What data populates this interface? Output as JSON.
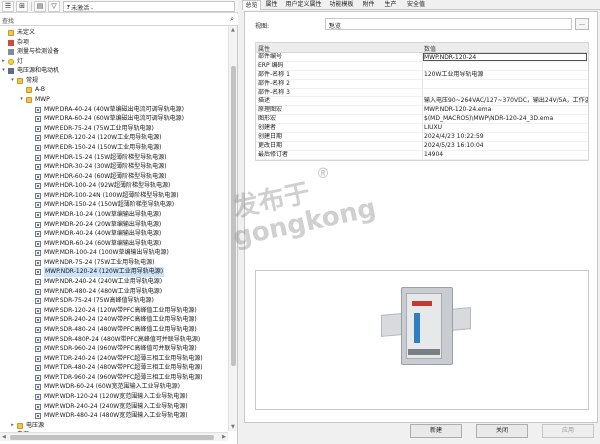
{
  "toolbar": {
    "combo_value": "- 未激活 -"
  },
  "search": {
    "value": "查找"
  },
  "tree": [
    {
      "label": "未定义",
      "depth": 1,
      "twisty": "",
      "icon": "folder"
    },
    {
      "label": "杂项",
      "depth": 1,
      "twisty": "",
      "icon": "book"
    },
    {
      "label": "测量与检测设备",
      "depth": 1,
      "twisty": "",
      "icon": "meter"
    },
    {
      "label": "灯",
      "depth": 1,
      "twisty": "▸",
      "icon": "bulb"
    },
    {
      "label": "电压源和电动机",
      "depth": 1,
      "twisty": "▾",
      "icon": "plug"
    },
    {
      "label": "常规",
      "depth": 2,
      "twisty": "▾",
      "icon": "folder"
    },
    {
      "label": "A-B",
      "depth": 3,
      "twisty": "",
      "icon": "folder"
    },
    {
      "label": "MWP",
      "depth": 3,
      "twisty": "▾",
      "icon": "folder"
    },
    {
      "label": "MWP.DRA-40-24 (40W草编磁出电流可调导轨电源)",
      "depth": 4,
      "icon": "prod"
    },
    {
      "label": "MWP.DRA-60-24 (60W草编磁出电流可调导轨电源)",
      "depth": 4,
      "icon": "prod"
    },
    {
      "label": "MWP.EDR-75-24 (75W工业用导轨电源)",
      "depth": 4,
      "icon": "prod"
    },
    {
      "label": "MWP.EDR-120-24 (120W工业用导轨电源)",
      "depth": 4,
      "icon": "prod"
    },
    {
      "label": "MWP.EDR-150-24 (150W工业用导轨电源)",
      "depth": 4,
      "icon": "prod"
    },
    {
      "label": "MWP.HDR-15-24 (15W超薄阶梯型导轨电源)",
      "depth": 4,
      "icon": "prod"
    },
    {
      "label": "MWP.HDR-30-24 (30W超薄阶梯型导轨电源)",
      "depth": 4,
      "icon": "prod"
    },
    {
      "label": "MWP.HDR-60-24 (60W超薄阶梯型导轨电源)",
      "depth": 4,
      "icon": "prod"
    },
    {
      "label": "MWP.HDR-100-24 (92W超薄阶梯型导轨电源)",
      "depth": 4,
      "icon": "prod"
    },
    {
      "label": "MWP.HDR-100-24N (100W超薄阶梯型导轨电源)",
      "depth": 4,
      "icon": "prod"
    },
    {
      "label": "MWP.HDR-150-24 (150W超薄阶梯型导轨电源)",
      "depth": 4,
      "icon": "prod"
    },
    {
      "label": "MWP.MDR-10-24 (10W草编输出导轨电源)",
      "depth": 4,
      "icon": "prod"
    },
    {
      "label": "MWP.MDR-20-24 (20W草编输出导轨电源)",
      "depth": 4,
      "icon": "prod"
    },
    {
      "label": "MWP.MDR-40-24 (40W草编输出导轨电源)",
      "depth": 4,
      "icon": "prod"
    },
    {
      "label": "MWP.MDR-60-24 (60W草编输出导轨电源)",
      "depth": 4,
      "icon": "prod"
    },
    {
      "label": "MWP.MDR-100-24 (100W草编输出导轨电源)",
      "depth": 4,
      "icon": "prod"
    },
    {
      "label": "MWP.NDR-75-24 (75W工业用导轨电源)",
      "depth": 4,
      "icon": "prod"
    },
    {
      "label": "MWP.NDR-120-24 (120W工业用导轨电源)",
      "depth": 4,
      "icon": "prod",
      "selected": true
    },
    {
      "label": "MWP.NDR-240-24 (240W工业用导轨电源)",
      "depth": 4,
      "icon": "prod"
    },
    {
      "label": "MWP.NDR-480-24 (480W工业用导轨电源)",
      "depth": 4,
      "icon": "prod"
    },
    {
      "label": "MWP.SDR-75-24 (75W高峰值导轨电源)",
      "depth": 4,
      "icon": "prod"
    },
    {
      "label": "MWP.SDR-120-24 (120W带PFC高峰值工业用导轨电源)",
      "depth": 4,
      "icon": "prod"
    },
    {
      "label": "MWP.SDR-240-24 (240W带PFC高峰值工业用导轨电源)",
      "depth": 4,
      "icon": "prod"
    },
    {
      "label": "MWP.SDR-480-24 (480W带PFC高峰值工业用导轨电源)",
      "depth": 4,
      "icon": "prod"
    },
    {
      "label": "MWP.SDR-480P-24 (480W带PFC高峰值可并联导轨电源)",
      "depth": 4,
      "icon": "prod"
    },
    {
      "label": "MWP.SDR-960-24 (960W带PFC高峰值可并联导轨电源)",
      "depth": 4,
      "icon": "prod"
    },
    {
      "label": "MWP.TDR-240-24 (240W带PFC超薄三相工业用导轨电源)",
      "depth": 4,
      "icon": "prod"
    },
    {
      "label": "MWP.TDR-480-24 (480W带PFC超薄三相工业用导轨电源)",
      "depth": 4,
      "icon": "prod"
    },
    {
      "label": "MWP.TDR-960-24 (960W带PFC超薄三相工业用导轨电源)",
      "depth": 4,
      "icon": "prod"
    },
    {
      "label": "MWP.WDR-60-24 (60W宽范围输入工业导轨电源)",
      "depth": 4,
      "icon": "prod"
    },
    {
      "label": "MWP.WDR-120-24 (120W宽范围输入工业导轨电源)",
      "depth": 4,
      "icon": "prod"
    },
    {
      "label": "MWP.WDR-240-24 (240W宽范围输入工业导轨电源)",
      "depth": 4,
      "icon": "prod"
    },
    {
      "label": "MWP.WDR-480-24 (480W宽范围输入工业导轨电源)",
      "depth": 4,
      "icon": "prod"
    },
    {
      "label": "电压源",
      "depth": 2,
      "twisty": "▸",
      "icon": "folder"
    },
    {
      "label": "电源",
      "depth": 1,
      "twisty": "▸",
      "icon": "folder"
    },
    {
      "label": "电机",
      "depth": 1,
      "twisty": "▸",
      "icon": "gear"
    }
  ],
  "tabs": [
    {
      "label": "总览",
      "active": true
    },
    {
      "label": "属性"
    },
    {
      "label": "用户定义属性"
    },
    {
      "label": "功能模板"
    },
    {
      "label": "附件"
    },
    {
      "label": "生产"
    },
    {
      "label": "安全值"
    }
  ],
  "view": {
    "label": "视图:",
    "value": "总览",
    "more_label": "..."
  },
  "grid": {
    "col_property": "属性",
    "col_value": "数值",
    "rows": [
      {
        "name": "部件编号",
        "value": "MWP.NDR-120-24",
        "hl": true
      },
      {
        "name": "ERP 编码",
        "value": ""
      },
      {
        "name": "部件-名称 1",
        "value": "120W工业用导轨电源"
      },
      {
        "name": "部件-名称 2",
        "value": ""
      },
      {
        "name": "部件-名称 3",
        "value": ""
      },
      {
        "name": "描述",
        "value": "输入电压90~264VAC/127~370VDC，输出24V/5A，工作温度-..."
      },
      {
        "name": "原理图宏",
        "value": "MWP.NDR-120-24.ema"
      },
      {
        "name": "图形宏",
        "value": "$(MD_MACROS)\\MWP\\NDR-120-24_3D.ema"
      },
      {
        "name": "创建者",
        "value": "LIUXU"
      },
      {
        "name": "创建日期",
        "value": "2024/4/23 10:22:59"
      },
      {
        "name": "更改日期",
        "value": "2024/5/23 16:10:04"
      },
      {
        "name": "最后修订者",
        "value": "14904"
      }
    ]
  },
  "buttons": {
    "new": "新建",
    "close": "关闭",
    "apply": "应用"
  },
  "watermark": {
    "cn": "发布于",
    "en": "gongkong",
    "reg": "®"
  }
}
